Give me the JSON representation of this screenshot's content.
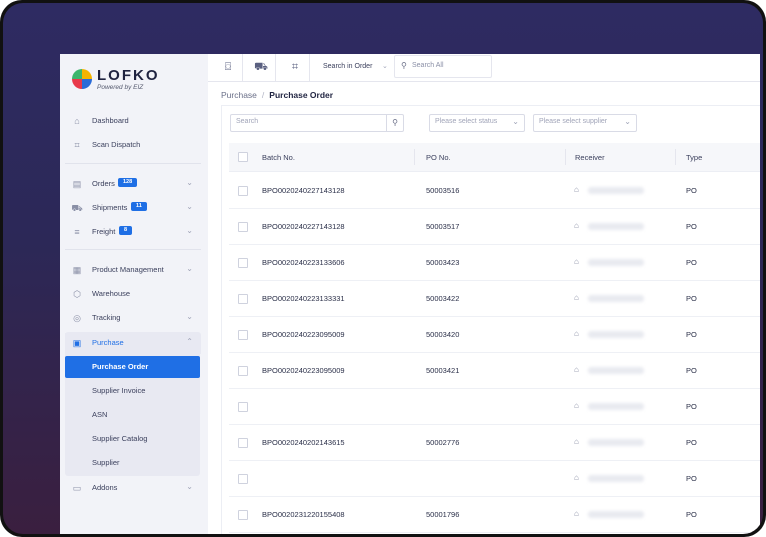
{
  "brand": {
    "name": "LOFKO",
    "tagline": "Powered by EIZ"
  },
  "sidebar": {
    "items": [
      {
        "label": "Dashboard",
        "icon": "home-icon"
      },
      {
        "label": "Scan Dispatch",
        "icon": "scan-icon"
      },
      {
        "label": "Orders",
        "icon": "orders-icon",
        "badge": "128"
      },
      {
        "label": "Shipments",
        "icon": "truck-icon",
        "badge": "11"
      },
      {
        "label": "Freight",
        "icon": "freight-icon",
        "badge": "8"
      },
      {
        "label": "Product Management",
        "icon": "product-icon"
      },
      {
        "label": "Warehouse",
        "icon": "box-icon"
      },
      {
        "label": "Tracking",
        "icon": "location-icon"
      },
      {
        "label": "Purchase",
        "icon": "purchase-icon"
      },
      {
        "label": "Addons",
        "icon": "inbox-icon"
      }
    ],
    "purchase_sub": [
      {
        "label": "Purchase Order",
        "active": true
      },
      {
        "label": "Supplier Invoice"
      },
      {
        "label": "ASN"
      },
      {
        "label": "Supplier Catalog"
      },
      {
        "label": "Supplier"
      }
    ]
  },
  "topbar": {
    "search_scope": "Search in Order",
    "search_placeholder": "Search All"
  },
  "breadcrumb": {
    "parent": "Purchase",
    "current": "Purchase Order"
  },
  "filters": {
    "search_placeholder": "Search",
    "status_placeholder": "Please select status",
    "supplier_placeholder": "Please select supplier"
  },
  "table": {
    "columns": [
      "Batch No.",
      "PO No.",
      "Receiver",
      "Type"
    ],
    "rows": [
      {
        "batch": "BPO0020240227143128",
        "po": "50003516",
        "type": "PO"
      },
      {
        "batch": "BPO0020240227143128",
        "po": "50003517",
        "type": "PO"
      },
      {
        "batch": "BPO0020240223133606",
        "po": "50003423",
        "type": "PO"
      },
      {
        "batch": "BPO0020240223133331",
        "po": "50003422",
        "type": "PO"
      },
      {
        "batch": "BPO0020240223095009",
        "po": "50003420",
        "type": "PO"
      },
      {
        "batch": "BPO0020240223095009",
        "po": "50003421",
        "type": "PO"
      },
      {
        "batch": "",
        "po": "",
        "type": "PO"
      },
      {
        "batch": "BPO0020240202143615",
        "po": "50002776",
        "type": "PO"
      },
      {
        "batch": "",
        "po": "",
        "type": "PO"
      },
      {
        "batch": "BPO0020231220155408",
        "po": "50001796",
        "type": "PO"
      }
    ]
  },
  "colors": {
    "accent": "#1f6fe5",
    "sidebar_bg": "#f2f3f8",
    "bezel": "#2e2b62"
  }
}
